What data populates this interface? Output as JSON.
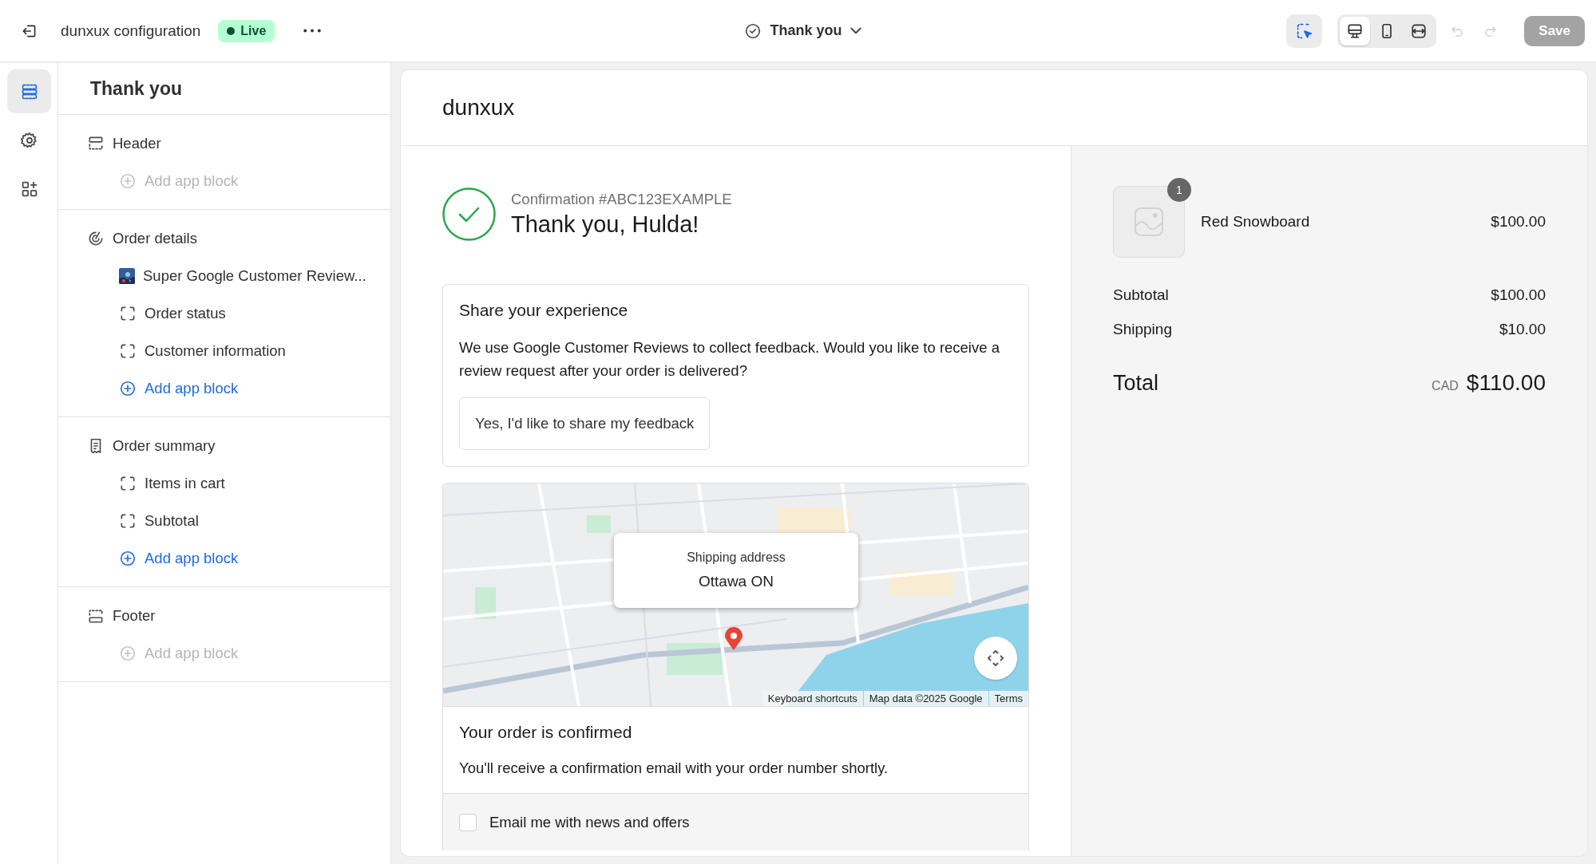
{
  "top_bar": {
    "title": "dunxux configuration",
    "status": {
      "label": "Live"
    },
    "page_selector": {
      "label": "Thank you"
    },
    "inspector": {
      "selected": true
    },
    "view_modes": [
      {
        "kind": "desktop",
        "selected": true
      },
      {
        "kind": "mobile",
        "selected": false
      },
      {
        "kind": "full_width",
        "selected": false
      }
    ],
    "undo": {
      "disabled": true
    },
    "redo": {
      "disabled": true
    },
    "save": {
      "label": "Save",
      "disabled": true
    }
  },
  "rail": [
    {
      "kind": "sections",
      "selected": true
    },
    {
      "kind": "settings",
      "selected": false
    },
    {
      "kind": "apps",
      "selected": false
    }
  ],
  "sidebar": {
    "title": "Thank you",
    "sections": [
      {
        "label": "Header",
        "kind": "header",
        "children": [
          {
            "label": "Add app block",
            "kind": "add",
            "disabled": true
          }
        ]
      },
      {
        "label": "Order details",
        "kind": "details",
        "children": [
          {
            "label": "Super Google Customer Review...",
            "kind": "app"
          },
          {
            "label": "Order status",
            "kind": "block"
          },
          {
            "label": "Customer information",
            "kind": "block"
          },
          {
            "label": "Add app block",
            "kind": "add",
            "disabled": false
          }
        ]
      },
      {
        "label": "Order summary",
        "kind": "summary",
        "children": [
          {
            "label": "Items in cart",
            "kind": "block"
          },
          {
            "label": "Subtotal",
            "kind": "block"
          },
          {
            "label": "Add app block",
            "kind": "add",
            "disabled": false
          }
        ]
      },
      {
        "label": "Footer",
        "kind": "footer",
        "children": [
          {
            "label": "Add app block",
            "kind": "add",
            "disabled": true
          }
        ]
      }
    ]
  },
  "preview": {
    "shop_name": "dunxux",
    "confirmation": {
      "number": "Confirmation #ABC123EXAMPLE",
      "greeting": "Thank you, Hulda!"
    },
    "feedback": {
      "title": "Share your experience",
      "text": "We use Google Customer Reviews to collect feedback. Would you like to receive a review request after your order is delivered?",
      "button": "Yes, I'd like to share my feedback"
    },
    "map": {
      "kind": "picture",
      "popup": {
        "label": "Shipping address",
        "value": "Ottawa ON"
      },
      "attribution": [
        "Keyboard shortcuts",
        "Map data ©2025 Google",
        "Terms"
      ]
    },
    "confirmed": {
      "title": "Your order is confirmed",
      "text": "You'll receive a confirmation email with your order number shortly."
    },
    "newsletter": {
      "label": "Email me with news and offers",
      "checked": false
    },
    "summary": {
      "items": [
        {
          "name": "Red Snowboard",
          "quantity": "1",
          "price": "$100.00"
        }
      ],
      "lines": [
        {
          "label": "Subtotal",
          "value": "$100.00"
        },
        {
          "label": "Shipping",
          "value": "$10.00"
        }
      ],
      "total": {
        "label": "Total",
        "currency": "CAD",
        "value": "$110.00"
      }
    }
  }
}
